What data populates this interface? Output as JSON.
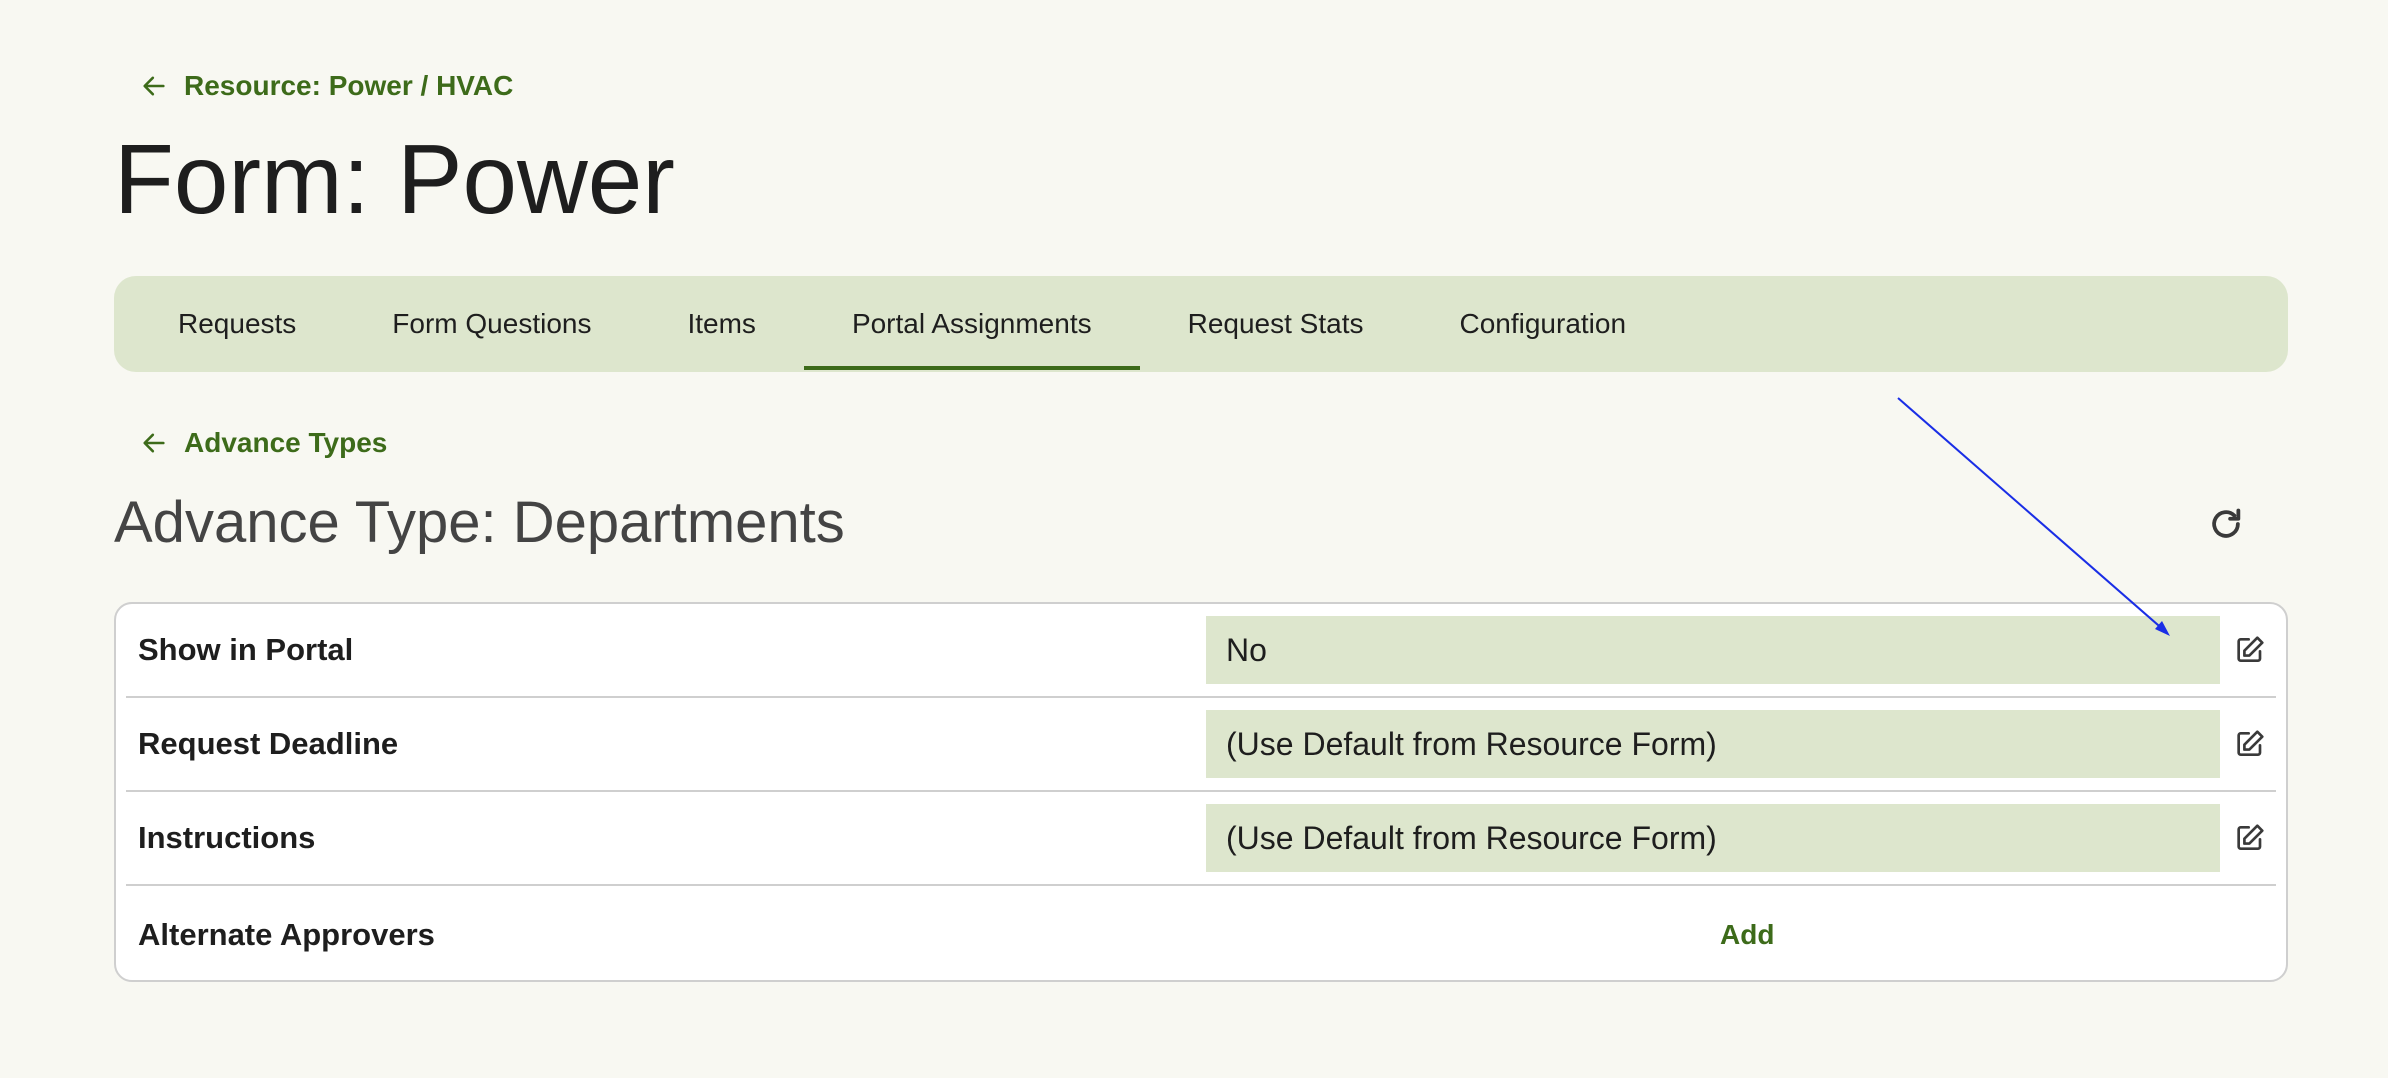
{
  "breadcrumb": {
    "back_label": "Resource: Power / HVAC",
    "icon": "arrow-left-icon"
  },
  "page": {
    "title": "Form: Power"
  },
  "tabs": [
    {
      "label": "Requests",
      "active": false
    },
    {
      "label": "Form Questions",
      "active": false
    },
    {
      "label": "Items",
      "active": false
    },
    {
      "label": "Portal Assignments",
      "active": true
    },
    {
      "label": "Request Stats",
      "active": false
    },
    {
      "label": "Configuration",
      "active": false
    }
  ],
  "sub_breadcrumb": {
    "back_label": "Advance Types",
    "icon": "arrow-left-icon"
  },
  "section": {
    "title": "Advance Type: Departments",
    "refresh_icon": "refresh-icon"
  },
  "rows": [
    {
      "label": "Show in Portal",
      "value": "No",
      "edit_icon": "edit-icon"
    },
    {
      "label": "Request Deadline",
      "value": "(Use Default from Resource Form)",
      "edit_icon": "edit-icon"
    },
    {
      "label": "Instructions",
      "value": "(Use Default from Resource Form)",
      "edit_icon": "edit-icon"
    },
    {
      "label": "Alternate Approvers",
      "action": "Add"
    }
  ],
  "colors": {
    "background": "#f8f8f2",
    "accent": "#3d6b1a",
    "tab_bar": "#dde6cd",
    "value_fill": "#dde6cd",
    "annotation_arrow": "#1a2ee6"
  }
}
